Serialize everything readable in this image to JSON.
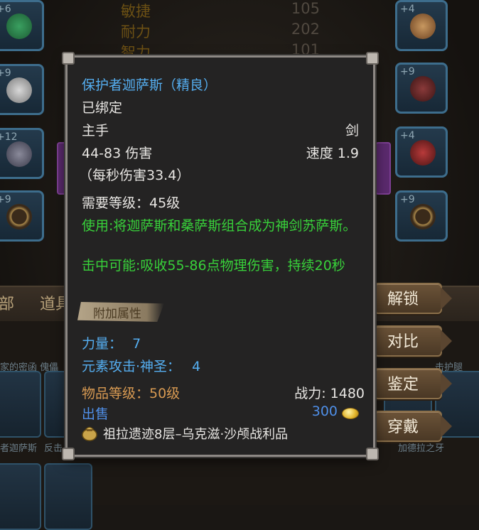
{
  "background": {
    "stats": [
      {
        "label": "敏捷",
        "value": "105"
      },
      {
        "label": "耐力",
        "value": "202"
      },
      {
        "label": "智力",
        "value": "101"
      }
    ],
    "left_slots": [
      {
        "plus": "+6"
      },
      {
        "plus": "+9"
      },
      {
        "plus": "+12"
      },
      {
        "plus": "+9"
      }
    ],
    "right_slots": [
      {
        "plus": "+4"
      },
      {
        "plus": "+9"
      },
      {
        "plus": "+4"
      },
      {
        "plus": "+9"
      }
    ],
    "tabs": [
      "部",
      "道具"
    ],
    "bottom_labels": [
      "家的密函 傀儡",
      "者迦萨斯",
      "反击",
      "击护腿",
      "加德拉之牙"
    ]
  },
  "tooltip": {
    "item_name": "保护者迦萨斯（精良）",
    "bind_status": "已绑定",
    "slot_type": "主手",
    "weapon_type": "剑",
    "damage": "44-83 伤害",
    "speed": "速度 1.9",
    "dps": "（每秒伤害33.4）",
    "required_level": "需要等级：45级",
    "use_effect": "使用:将迦萨斯和桑萨斯组合成为神剑苏萨斯。",
    "proc_effect": "击中可能:吸收55-86点物理伤害，持续20秒",
    "bonus_header": "附加属性",
    "bonus_stats": [
      {
        "label": "力量：",
        "value": "7"
      },
      {
        "label": "元素攻击·神圣：",
        "value": "4"
      }
    ],
    "item_level": "物品等级：50级",
    "combat_power": "战力: 1480",
    "sell_label": "出售",
    "sell_price": "300",
    "source": "祖拉遗迹8层–乌克滋·沙颅战利品"
  },
  "actions": {
    "unlock": "解锁",
    "compare": "对比",
    "identify": "鉴定",
    "equip": "穿戴"
  },
  "colors": {
    "item_name": "#55aef0",
    "effect_green": "#38d13a",
    "item_level_orange": "#d89a52",
    "tooltip_bg": "#242323"
  }
}
